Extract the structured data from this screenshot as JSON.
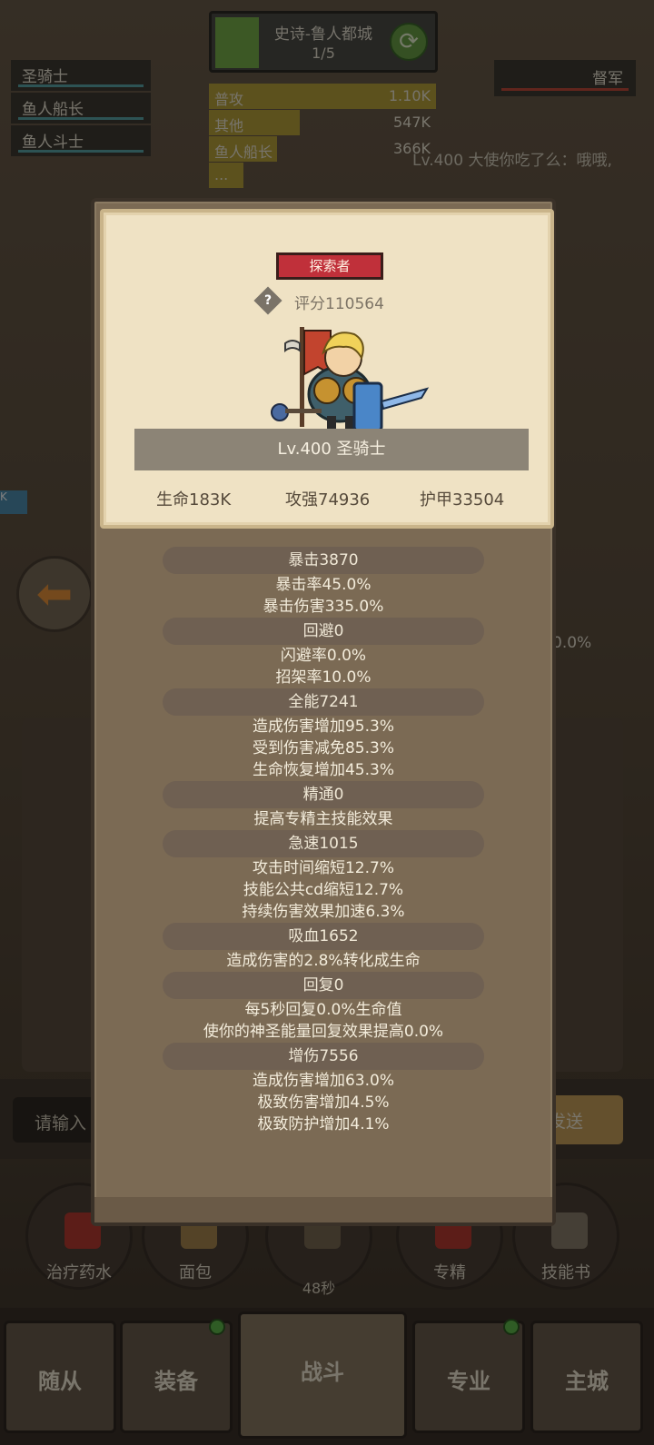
{
  "background": {
    "dungeon": {
      "name": "史诗-鲁人都城",
      "progress": "1/5"
    },
    "party": [
      "圣骑士",
      "鱼人船长",
      "鱼人斗士"
    ],
    "boss": "督军",
    "damage_meter": [
      {
        "name": "普攻",
        "value": "1.10K",
        "fill": 1.0
      },
      {
        "name": "其他",
        "value": "547K",
        "fill": 0.4
      },
      {
        "name": "鱼人船长",
        "value": "366K",
        "fill": 0.3
      },
      {
        "name": "...",
        "value": "",
        "fill": 0.15
      }
    ],
    "chat_line": "Lv.400 大使你吃了么：哦哦,",
    "side_badge": "K",
    "pct": "0.0%",
    "chat_input_placeholder": "请输入",
    "send_label": "发送",
    "items": [
      {
        "label": "治疗药水",
        "timer": ""
      },
      {
        "label": "面包",
        "timer": ""
      },
      {
        "label": "",
        "timer": "48秒"
      },
      {
        "label": "专精",
        "timer": ""
      },
      {
        "label": "技能书",
        "timer": ""
      }
    ],
    "nav": [
      "随从",
      "装备",
      "战斗",
      "专业",
      "主城"
    ]
  },
  "card": {
    "title": "探索者",
    "score": "评分110564",
    "help": "?",
    "name": "Lv.400 圣骑士",
    "hp": "生命183K",
    "atk": "攻强74936",
    "armor": "护甲33504"
  },
  "stats": [
    {
      "head": "暴击3870",
      "lines": [
        "暴击率45.0%",
        "暴击伤害335.0%"
      ]
    },
    {
      "head": "回避0",
      "lines": [
        "闪避率0.0%",
        "招架率10.0%"
      ]
    },
    {
      "head": "全能7241",
      "lines": [
        "造成伤害增加95.3%",
        "受到伤害减免85.3%",
        "生命恢复增加45.3%"
      ]
    },
    {
      "head": "精通0",
      "lines": [
        "提高专精主技能效果"
      ]
    },
    {
      "head": "急速1015",
      "lines": [
        "攻击时间缩短12.7%",
        "技能公共cd缩短12.7%",
        "持续伤害效果加速6.3%"
      ]
    },
    {
      "head": "吸血1652",
      "lines": [
        "造成伤害的2.8%转化成生命"
      ]
    },
    {
      "head": "回复0",
      "lines": [
        "每5秒回复0.0%生命值",
        "使你的神圣能量回复效果提高0.0%"
      ]
    },
    {
      "head": "增伤7556",
      "lines": [
        "造成伤害增加63.0%",
        "极致伤害增加4.5%",
        "极致防护增加4.1%"
      ]
    }
  ]
}
